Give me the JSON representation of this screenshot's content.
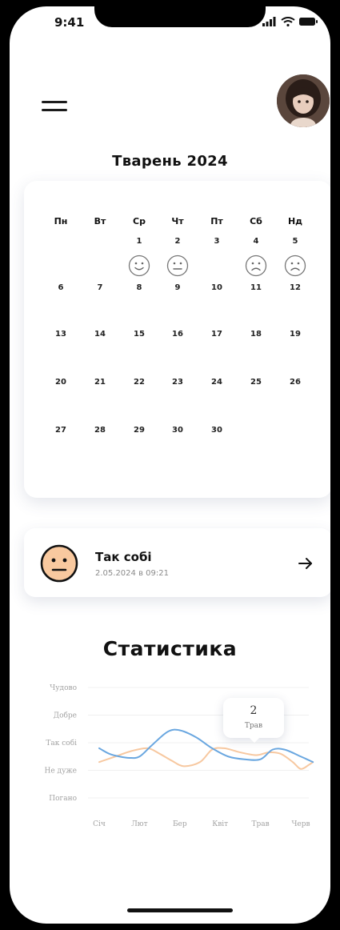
{
  "status_bar": {
    "time": "9:41"
  },
  "header": {
    "month_title": "Тварень 2024"
  },
  "calendar": {
    "weekdays": [
      "Пн",
      "Вт",
      "Ср",
      "Чт",
      "Пт",
      "Сб",
      "Нд"
    ],
    "weeks": [
      [
        "",
        "",
        "1",
        "2",
        "3",
        "4",
        "5"
      ],
      [
        "6",
        "7",
        "8",
        "9",
        "10",
        "11",
        "12"
      ],
      [
        "13",
        "14",
        "15",
        "16",
        "17",
        "18",
        "19"
      ],
      [
        "20",
        "21",
        "22",
        "23",
        "24",
        "25",
        "26"
      ],
      [
        "27",
        "28",
        "29",
        "30",
        "30",
        "",
        ""
      ]
    ],
    "moods": [
      {
        "day": "1",
        "mood": "happy-face-icon"
      },
      {
        "day": "2",
        "mood": "neutral-face-icon"
      },
      {
        "day": "4",
        "mood": "sad-face-icon"
      },
      {
        "day": "5",
        "mood": "sad-face-icon"
      }
    ]
  },
  "entry": {
    "title": "Так собі",
    "date": "2.05.2024 в 09:21",
    "face_color": "#f9c99f"
  },
  "stats": {
    "title": "Статистика"
  },
  "chart_data": {
    "type": "line",
    "categories": [
      "Січ",
      "Лют",
      "Бер",
      "Квіт",
      "Трав",
      "Черв"
    ],
    "y_levels": [
      "Погано",
      "Не дуже",
      "Так собі",
      "Добре",
      "Чудово"
    ],
    "ylim": [
      0,
      4
    ],
    "grid": true,
    "series": [
      {
        "color": "#6aa7e0",
        "x": [
          0.0,
          0.25,
          0.5,
          0.75,
          1.0,
          1.3,
          1.7,
          2.0,
          2.4,
          2.8,
          3.2,
          3.6,
          4.0,
          4.3,
          4.6,
          5.0,
          5.3
        ],
        "values": [
          1.8,
          1.6,
          1.5,
          1.45,
          1.5,
          1.9,
          2.4,
          2.45,
          2.2,
          1.8,
          1.5,
          1.4,
          1.4,
          1.75,
          1.75,
          1.5,
          1.3
        ]
      },
      {
        "color": "#f7c8a0",
        "x": [
          0.0,
          0.4,
          0.8,
          1.2,
          1.5,
          1.8,
          2.1,
          2.5,
          2.8,
          3.1,
          3.5,
          3.9,
          4.2,
          4.5,
          4.8,
          5.0,
          5.2,
          5.3
        ],
        "values": [
          1.3,
          1.5,
          1.7,
          1.8,
          1.6,
          1.35,
          1.15,
          1.3,
          1.75,
          1.8,
          1.65,
          1.55,
          1.65,
          1.6,
          1.3,
          1.05,
          1.2,
          1.3
        ]
      }
    ],
    "tooltip": {
      "value": "2",
      "label": "Трав"
    }
  }
}
